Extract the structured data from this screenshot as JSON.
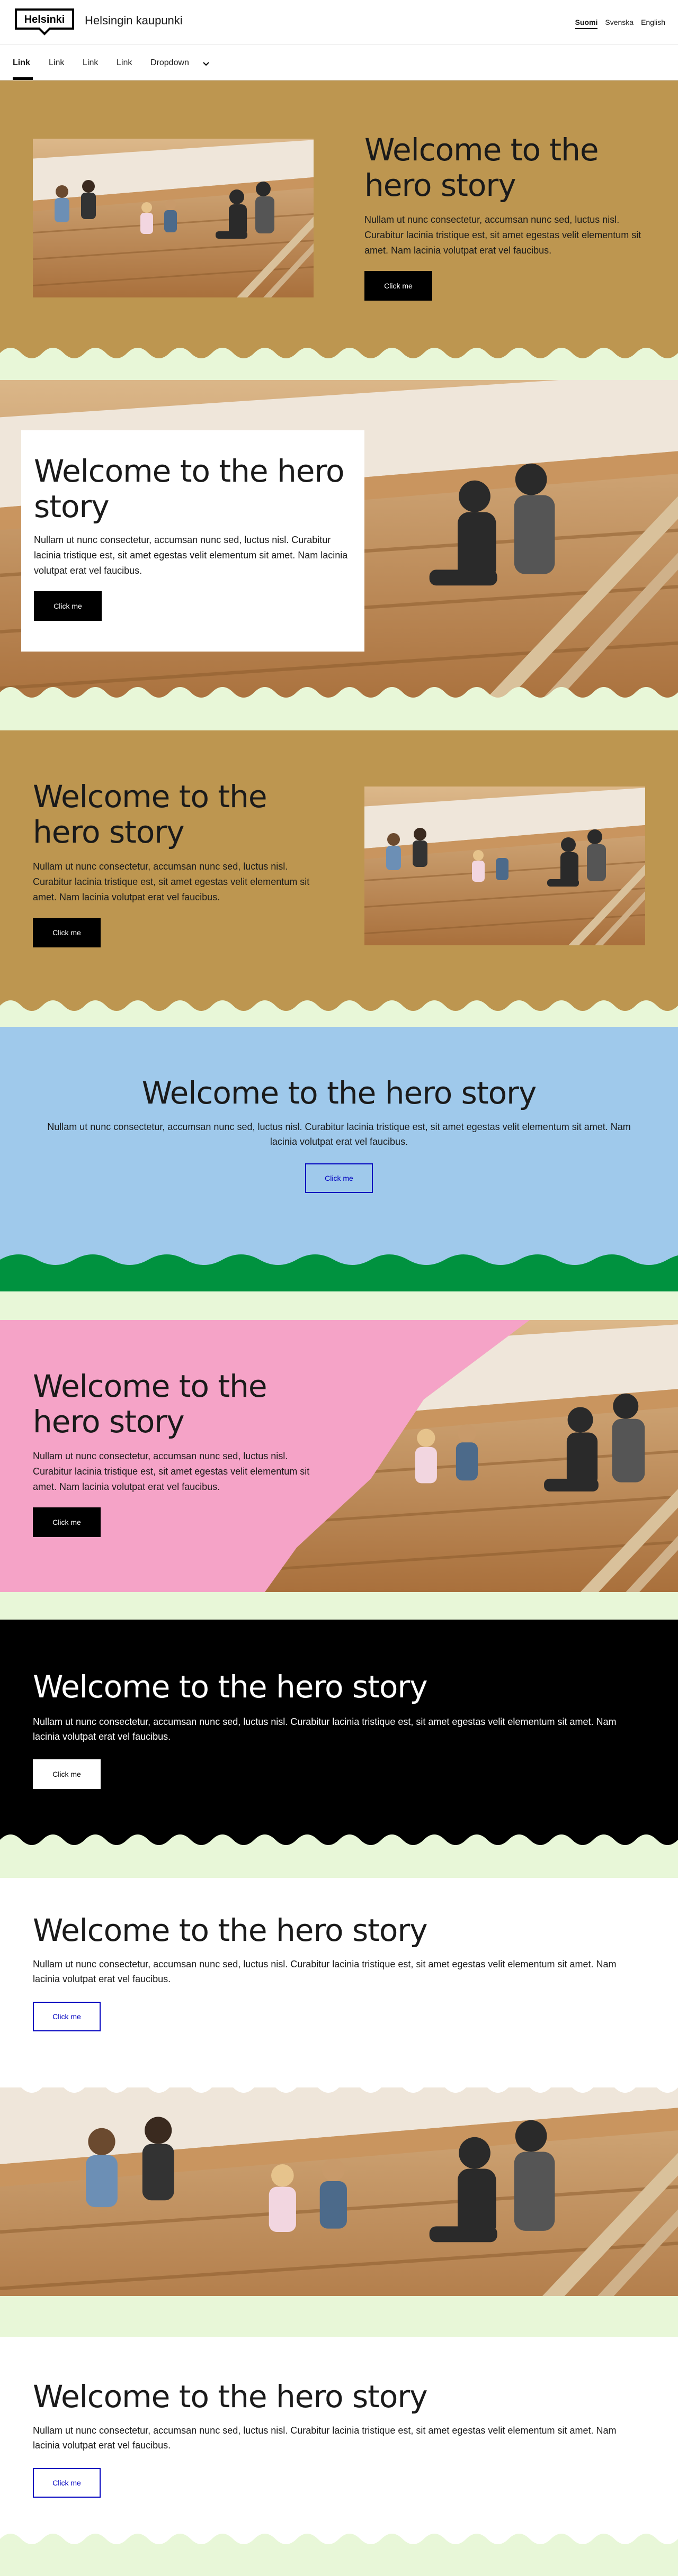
{
  "header": {
    "logo_text": "Helsinki",
    "brand_name": "Helsingin kaupunki",
    "languages": [
      "Suomi",
      "Svenska",
      "English"
    ]
  },
  "nav": {
    "items": [
      "Link",
      "Link",
      "Link",
      "Link",
      "Dropdown"
    ]
  },
  "hero": {
    "title": "Welcome to the hero story",
    "description": "Nullam ut nunc consectetur, accumsan nunc sed, luctus nisl. Curabitur lacinia tristique est, sit amet egestas velit elementum sit amet. Nam lacinia volutpat erat vel faucibus.",
    "button_label": "Click me"
  },
  "colors": {
    "gold": "#bd9650",
    "light_green": "#e8f7d8",
    "summer_blue": "#9fc9eb",
    "tram_green": "#00923f",
    "pink": "#f5a3c7",
    "coat_blue": "#0000bf",
    "black": "#000000"
  },
  "icons": [
    "chevron-down-icon"
  ]
}
